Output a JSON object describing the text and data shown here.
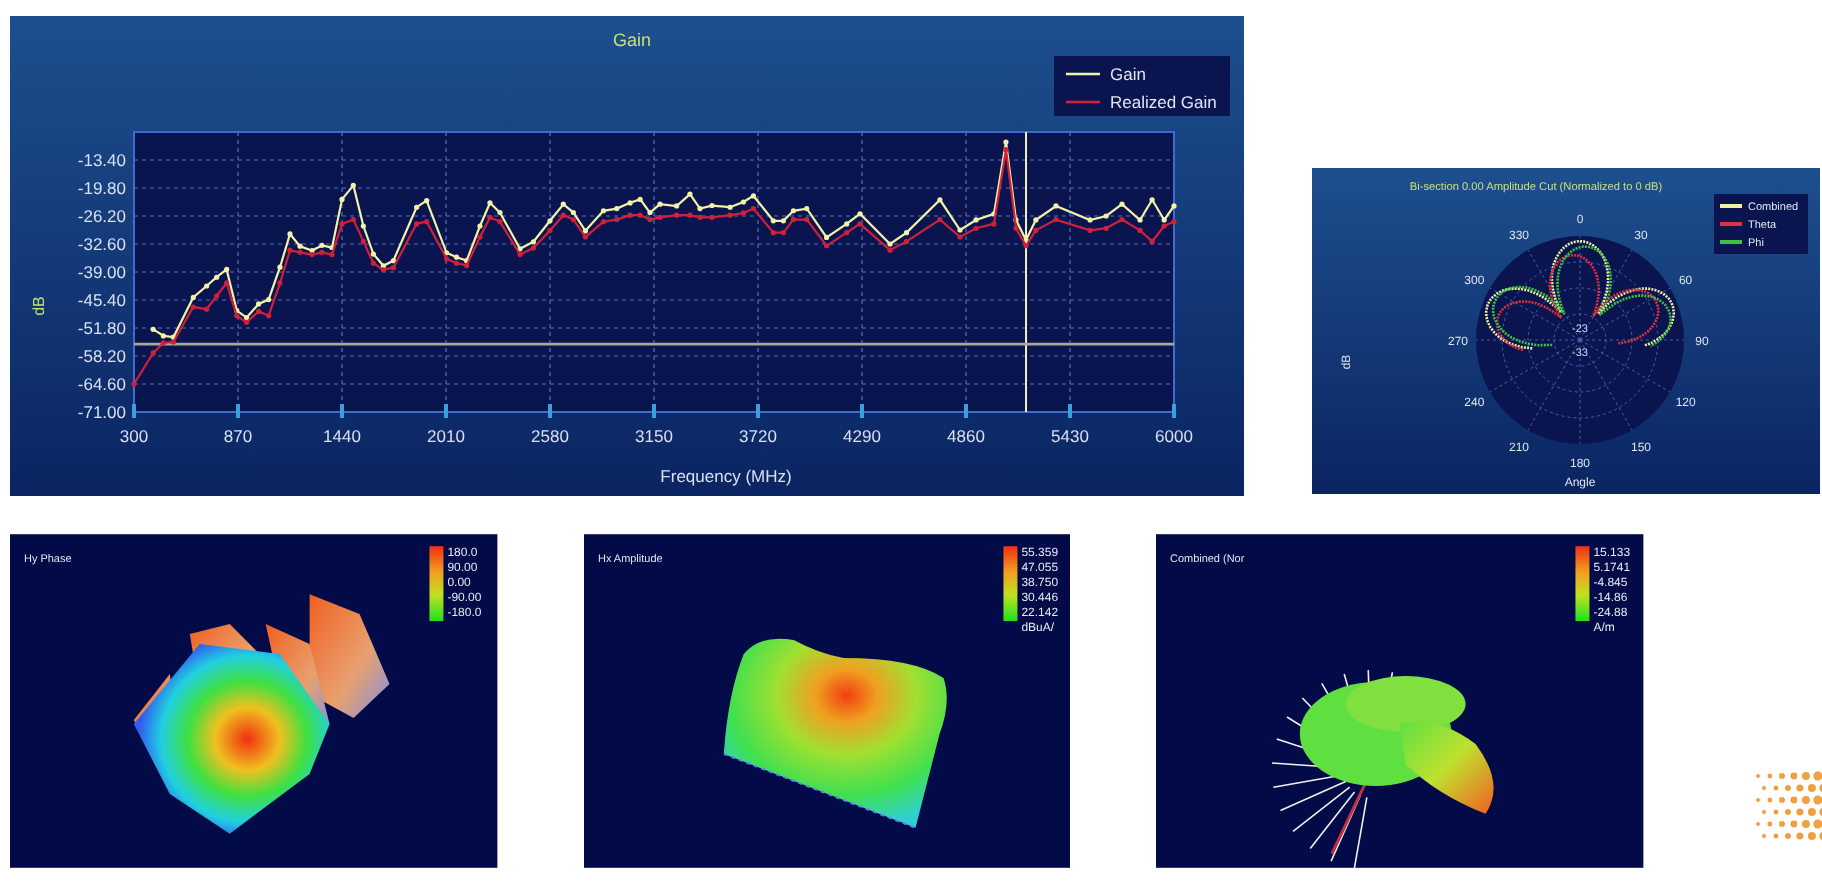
{
  "gain_chart": {
    "chart_data": {
      "type": "line",
      "title": "Gain",
      "xlabel": "Frequency (MHz)",
      "ylabel": "dB",
      "x": [
        300,
        405,
        461,
        516,
        625,
        698,
        753,
        808,
        863,
        917,
        983,
        1038,
        1100,
        1155,
        1210,
        1276,
        1330,
        1385,
        1440,
        1502,
        1557,
        1612,
        1667,
        1722,
        1849,
        1904,
        2013,
        2068,
        2123,
        2196,
        2251,
        2306,
        2416,
        2489,
        2580,
        2653,
        2708,
        2774,
        2873,
        2946,
        3019,
        3074,
        3128,
        3183,
        3274,
        3347,
        3402,
        3468,
        3567,
        3640,
        3695,
        3804,
        3859,
        3914,
        3987,
        4096,
        4206,
        4279,
        4444,
        4534,
        4717,
        4827,
        4915,
        5013,
        5079,
        5134,
        5189,
        5243,
        5353,
        5540,
        5628,
        5715,
        5814,
        5880,
        5946,
        6000
      ],
      "series": [
        {
          "name": "Gain",
          "color": "#f2f2a8",
          "values": [
            null,
            -52.1,
            -53.6,
            -53.9,
            -44.8,
            -42.2,
            -40.2,
            -38.4,
            -47.8,
            -49.4,
            -46.3,
            -45.3,
            -37.9,
            -30.3,
            -33.1,
            -34.1,
            -32.9,
            -33.4,
            -22.4,
            -19.2,
            -28.5,
            -34.9,
            -37.6,
            -36.4,
            -24.2,
            -22.7,
            -34.6,
            -35.6,
            -36.4,
            -28.5,
            -23.2,
            -25.4,
            -33.7,
            -32.1,
            -27.3,
            -23.5,
            -25.4,
            -29.6,
            -25.0,
            -24.5,
            -23.2,
            -22.4,
            -25.4,
            -23.5,
            -23.9,
            -21.2,
            -24.5,
            -23.8,
            -24.2,
            -23.0,
            -21.6,
            -27.3,
            -27.3,
            -25.0,
            -24.5,
            -31.1,
            -28.0,
            -25.7,
            -32.6,
            -30.0,
            -22.5,
            -29.4,
            -27.1,
            -25.7,
            -9.3,
            -27.1,
            -31.7,
            -27.1,
            -23.9,
            -27.1,
            -26.2,
            -23.5,
            -27.1,
            -22.5,
            -27.1,
            -23.9
          ]
        },
        {
          "name": "Realized Gain",
          "color": "#d0203a",
          "values": [
            -64.6,
            -57.5,
            -55.2,
            -55.0,
            -47.0,
            -47.5,
            -44.5,
            -41.5,
            -49.0,
            -50.5,
            -48.0,
            -49.0,
            -41.5,
            -34.0,
            -34.5,
            -35.0,
            -34.5,
            -35.0,
            -28.0,
            -27.0,
            -32.0,
            -37.0,
            -38.5,
            -38.0,
            -28.0,
            -27.5,
            -36.0,
            -37.0,
            -37.5,
            -31.0,
            -26.5,
            -27.5,
            -35.0,
            -33.5,
            -29.5,
            -26.0,
            -27.0,
            -31.0,
            -27.5,
            -27.0,
            -26.0,
            -26.0,
            -27.0,
            -26.5,
            -26.0,
            -26.0,
            -26.5,
            -26.5,
            -26.0,
            -25.5,
            -24.5,
            -30.0,
            -30.0,
            -27.0,
            -27.0,
            -33.0,
            -30.0,
            -28.0,
            -34.0,
            -32.0,
            -27.0,
            -31.0,
            -29.0,
            -28.0,
            -11.0,
            -29.0,
            -33.0,
            -29.5,
            -27.0,
            -29.5,
            -29.0,
            -27.0,
            -29.5,
            -32.0,
            -28.5,
            -27.5
          ]
        }
      ],
      "xlim": [
        300,
        6000
      ],
      "ylim": [
        -71,
        -7
      ],
      "xticks": [
        300,
        870,
        1440,
        2010,
        2580,
        3150,
        3720,
        4290,
        4860,
        5430,
        6000
      ],
      "yticks": [
        {
          "value": -13.4,
          "label": "-13.40"
        },
        {
          "value": -19.8,
          "label": "-19.80"
        },
        {
          "value": -26.2,
          "label": "-26.20"
        },
        {
          "value": -32.6,
          "label": "-32.60"
        },
        {
          "value": -39,
          "label": "-39.00"
        },
        {
          "value": -45.4,
          "label": "-45.40"
        },
        {
          "value": -51.8,
          "label": "-51.80"
        },
        {
          "value": -58.2,
          "label": "-58.20"
        },
        {
          "value": -64.6,
          "label": "-64.60"
        },
        {
          "value": -71,
          "label": "-71.00"
        }
      ],
      "grid": true,
      "legend": true,
      "ref_lines": [
        {
          "axis": "x",
          "value": 5189
        },
        {
          "axis": "y",
          "value": -55.5
        }
      ]
    }
  },
  "polar_chart": {
    "title": "Bi-section 0.00 Amplitude Cut (Normalized to 0 dB)",
    "ylabel": "dB",
    "xlabel": "Angle",
    "legend": [
      {
        "label": "Combined",
        "color": "#f0f0a0"
      },
      {
        "label": "Theta",
        "color": "#e03040"
      },
      {
        "label": "Phi",
        "color": "#40c040"
      }
    ],
    "angle_labels": [
      "0",
      "30",
      "60",
      "90",
      "120",
      "150",
      "180",
      "210",
      "240",
      "270",
      "300",
      "330"
    ],
    "ring_labels": [
      "-23",
      "-33"
    ]
  },
  "field_plots": [
    {
      "kind": "phase",
      "title": "Hy Phase",
      "scale_labels": [
        "180.0",
        "90.00",
        "0.00",
        "-90.00",
        "-180.0"
      ]
    },
    {
      "kind": "amplitude",
      "title": "Hx Amplitude",
      "scale_labels": [
        "55.359",
        "47.055",
        "38.750",
        "30.446",
        "22.142",
        "dBuA/"
      ]
    },
    {
      "kind": "pattern",
      "title": "Combined (Nor",
      "scale_labels": [
        "15.133",
        "5.1741",
        "-4.845",
        "-14.86",
        "-24.88",
        "A/m"
      ]
    }
  ]
}
